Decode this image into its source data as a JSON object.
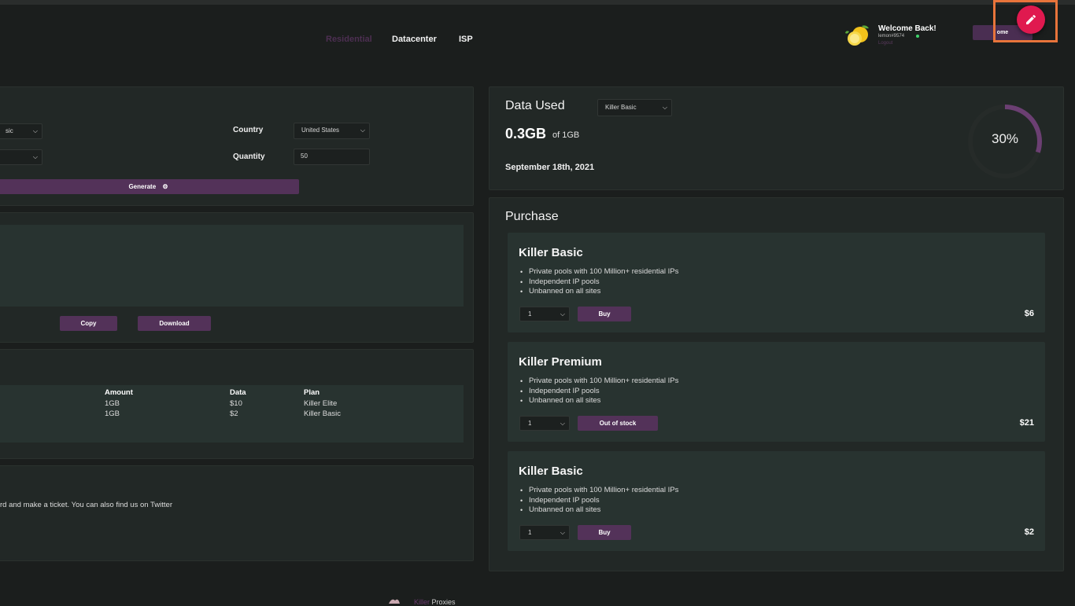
{
  "nav": {
    "items": [
      {
        "label": "Residential",
        "active": true
      },
      {
        "label": "Datacenter",
        "active": false
      },
      {
        "label": "ISP",
        "active": false
      }
    ]
  },
  "user": {
    "welcome": "Welcome Back!",
    "username": "lemon#9574",
    "logout": "Logout",
    "home_button": "ome"
  },
  "generator": {
    "plan_select_value": "sic",
    "second_select_value": "",
    "country_label": "Country",
    "country_value": "United States",
    "quantity_label": "Quantity",
    "quantity_value": "50",
    "generate_label": "Generate"
  },
  "output": {
    "copy_label": "Copy",
    "download_label": "Download"
  },
  "history": {
    "columns": [
      "Amount",
      "Data",
      "Plan"
    ],
    "rows": [
      [
        "1GB",
        "$10",
        "Killer Elite"
      ],
      [
        "1GB",
        "$2",
        "Killer Basic"
      ]
    ]
  },
  "support": {
    "text": "rd and make a ticket. You can also find us on Twitter"
  },
  "usage": {
    "title": "Data Used",
    "plan_select": "Killer Basic",
    "amount": "0.3GB",
    "of_text": "of 1GB",
    "date": "September 18th, 2021",
    "percent_label": "30%",
    "percent": 30
  },
  "purchase": {
    "title": "Purchase",
    "cards": [
      {
        "title": "Killer Basic",
        "features": [
          "Private pools with 100 Million+ residential IPs",
          "Independent IP pools",
          "Unbanned on all sites"
        ],
        "qty": "1",
        "button": "Buy",
        "price": "$6"
      },
      {
        "title": "Killer Premium",
        "features": [
          "Private pools with 100 Million+ residential IPs",
          "Independent IP pools",
          "Unbanned on all sites"
        ],
        "qty": "1",
        "button": "Out of stock",
        "price": "$21"
      },
      {
        "title": "Killer Basic",
        "features": [
          "Private pools with 100 Million+ residential IPs",
          "Independent IP pools",
          "Unbanned on all sites"
        ],
        "qty": "1",
        "button": "Buy",
        "price": "$2"
      }
    ]
  },
  "footer": {
    "brand_accent": "Killer",
    "brand_rest": " Proxies"
  },
  "colors": {
    "accent_purple": "#533259",
    "fab_red": "#e0194f",
    "highlight_orange": "#e8743b",
    "ring_purple": "#6b3f72"
  },
  "icons": {
    "fab": "pencil-icon",
    "generate": "gear-icon",
    "select": "chevron-down-icon"
  }
}
